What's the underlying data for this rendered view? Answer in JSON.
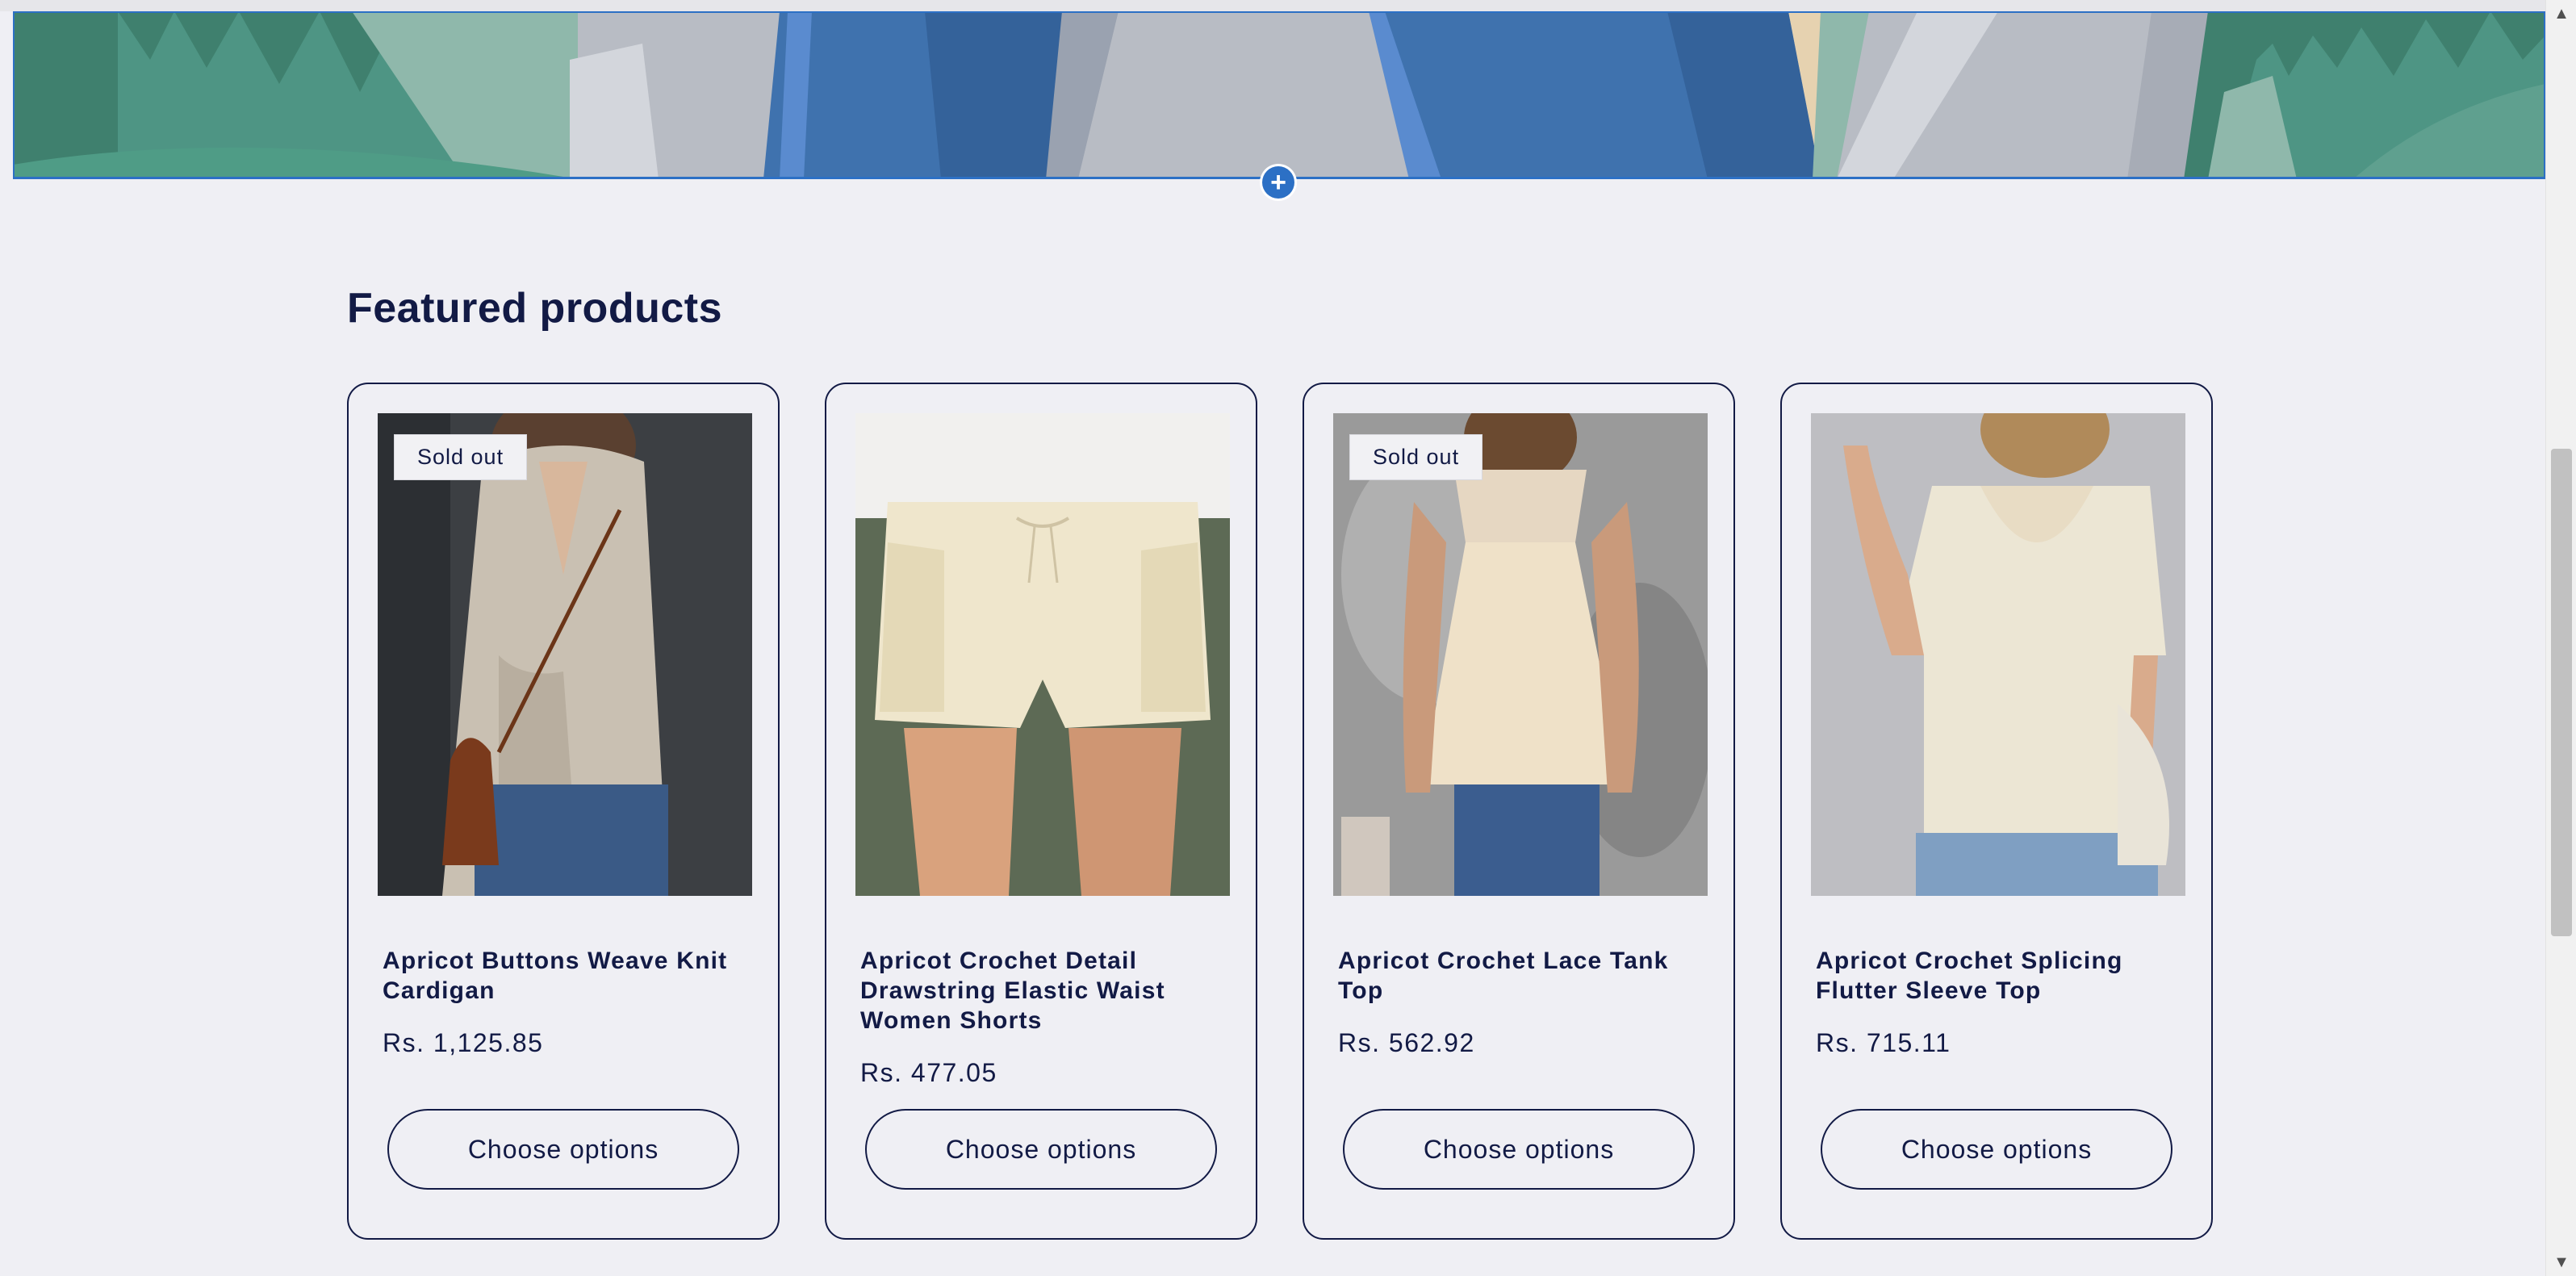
{
  "section": {
    "title": "Featured products",
    "add_section_icon": "plus-icon"
  },
  "products": [
    {
      "title": "Apricot Buttons Weave Knit Cardigan",
      "price": "Rs. 1,125.85",
      "badge": "Sold out",
      "button": "Choose options"
    },
    {
      "title": "Apricot Crochet Detail Drawstring Elastic Waist Women Shorts",
      "price": "Rs. 477.05",
      "badge": "",
      "button": "Choose options"
    },
    {
      "title": "Apricot Crochet Lace Tank Top",
      "price": "Rs. 562.92",
      "badge": "Sold out",
      "button": "Choose options"
    },
    {
      "title": "Apricot Crochet Splicing Flutter Sleeve Top",
      "price": "Rs. 715.11",
      "badge": "",
      "button": "Choose options"
    }
  ],
  "colors": {
    "accent": "#2c70c5",
    "text": "#121a45",
    "background": "#efeff4",
    "banner_green": "#3f806e",
    "banner_blue": "#3d6ea8",
    "banner_gray": "#b8bcc4"
  },
  "scrollbar": {
    "up_icon": "arrow-up-icon",
    "down_icon": "arrow-down-icon"
  }
}
